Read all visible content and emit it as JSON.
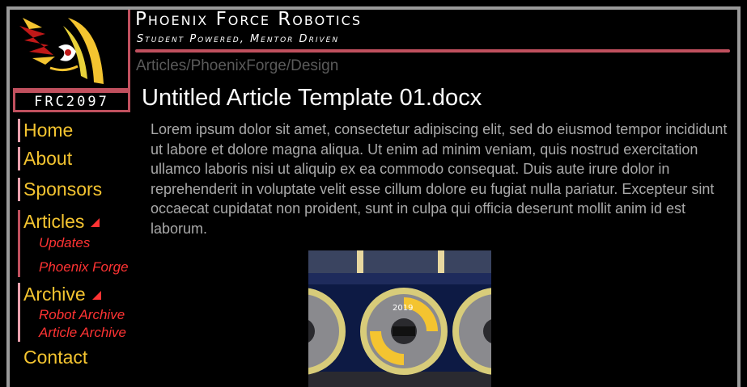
{
  "site": {
    "title": "Phoenix Force Robotics",
    "tagline": "Student Powered, Mentor Driven",
    "team_number": "FRC2097",
    "accent": "#c0505e"
  },
  "breadcrumb": "Articles/PhoenixForge/Design",
  "article": {
    "title": "Untitled Article Template 01.docx",
    "body": "Lorem ipsum dolor sit amet, consectetur adipiscing elit, sed do eiusmod tempor incididunt ut labore et dolore magna aliqua. Ut enim ad minim veniam, quis nostrud exercitation ullamco laboris nisi ut aliquip ex ea commodo consequat. Duis aute irure dolor in reprehenderit in voluptate velit esse cillum dolore eu fugiat nulla pariatur. Excepteur sint occaecat cupidatat non proident, sunt in culpa qui officia deserunt mollit anim id est laborum.",
    "photo_label": "2019"
  },
  "nav": {
    "home": "Home",
    "about": "About",
    "sponsors": "Sponsors",
    "articles": "Articles",
    "articles_sub": [
      "Updates",
      "Phoenix Forge"
    ],
    "archive": "Archive",
    "archive_sub": [
      "Robot Archive",
      "Article Archive"
    ],
    "contact": "Contact"
  },
  "colors": {
    "nav_link": "#f4c430",
    "nav_sub": "#ff3333",
    "body_text": "#a9a9a9"
  }
}
